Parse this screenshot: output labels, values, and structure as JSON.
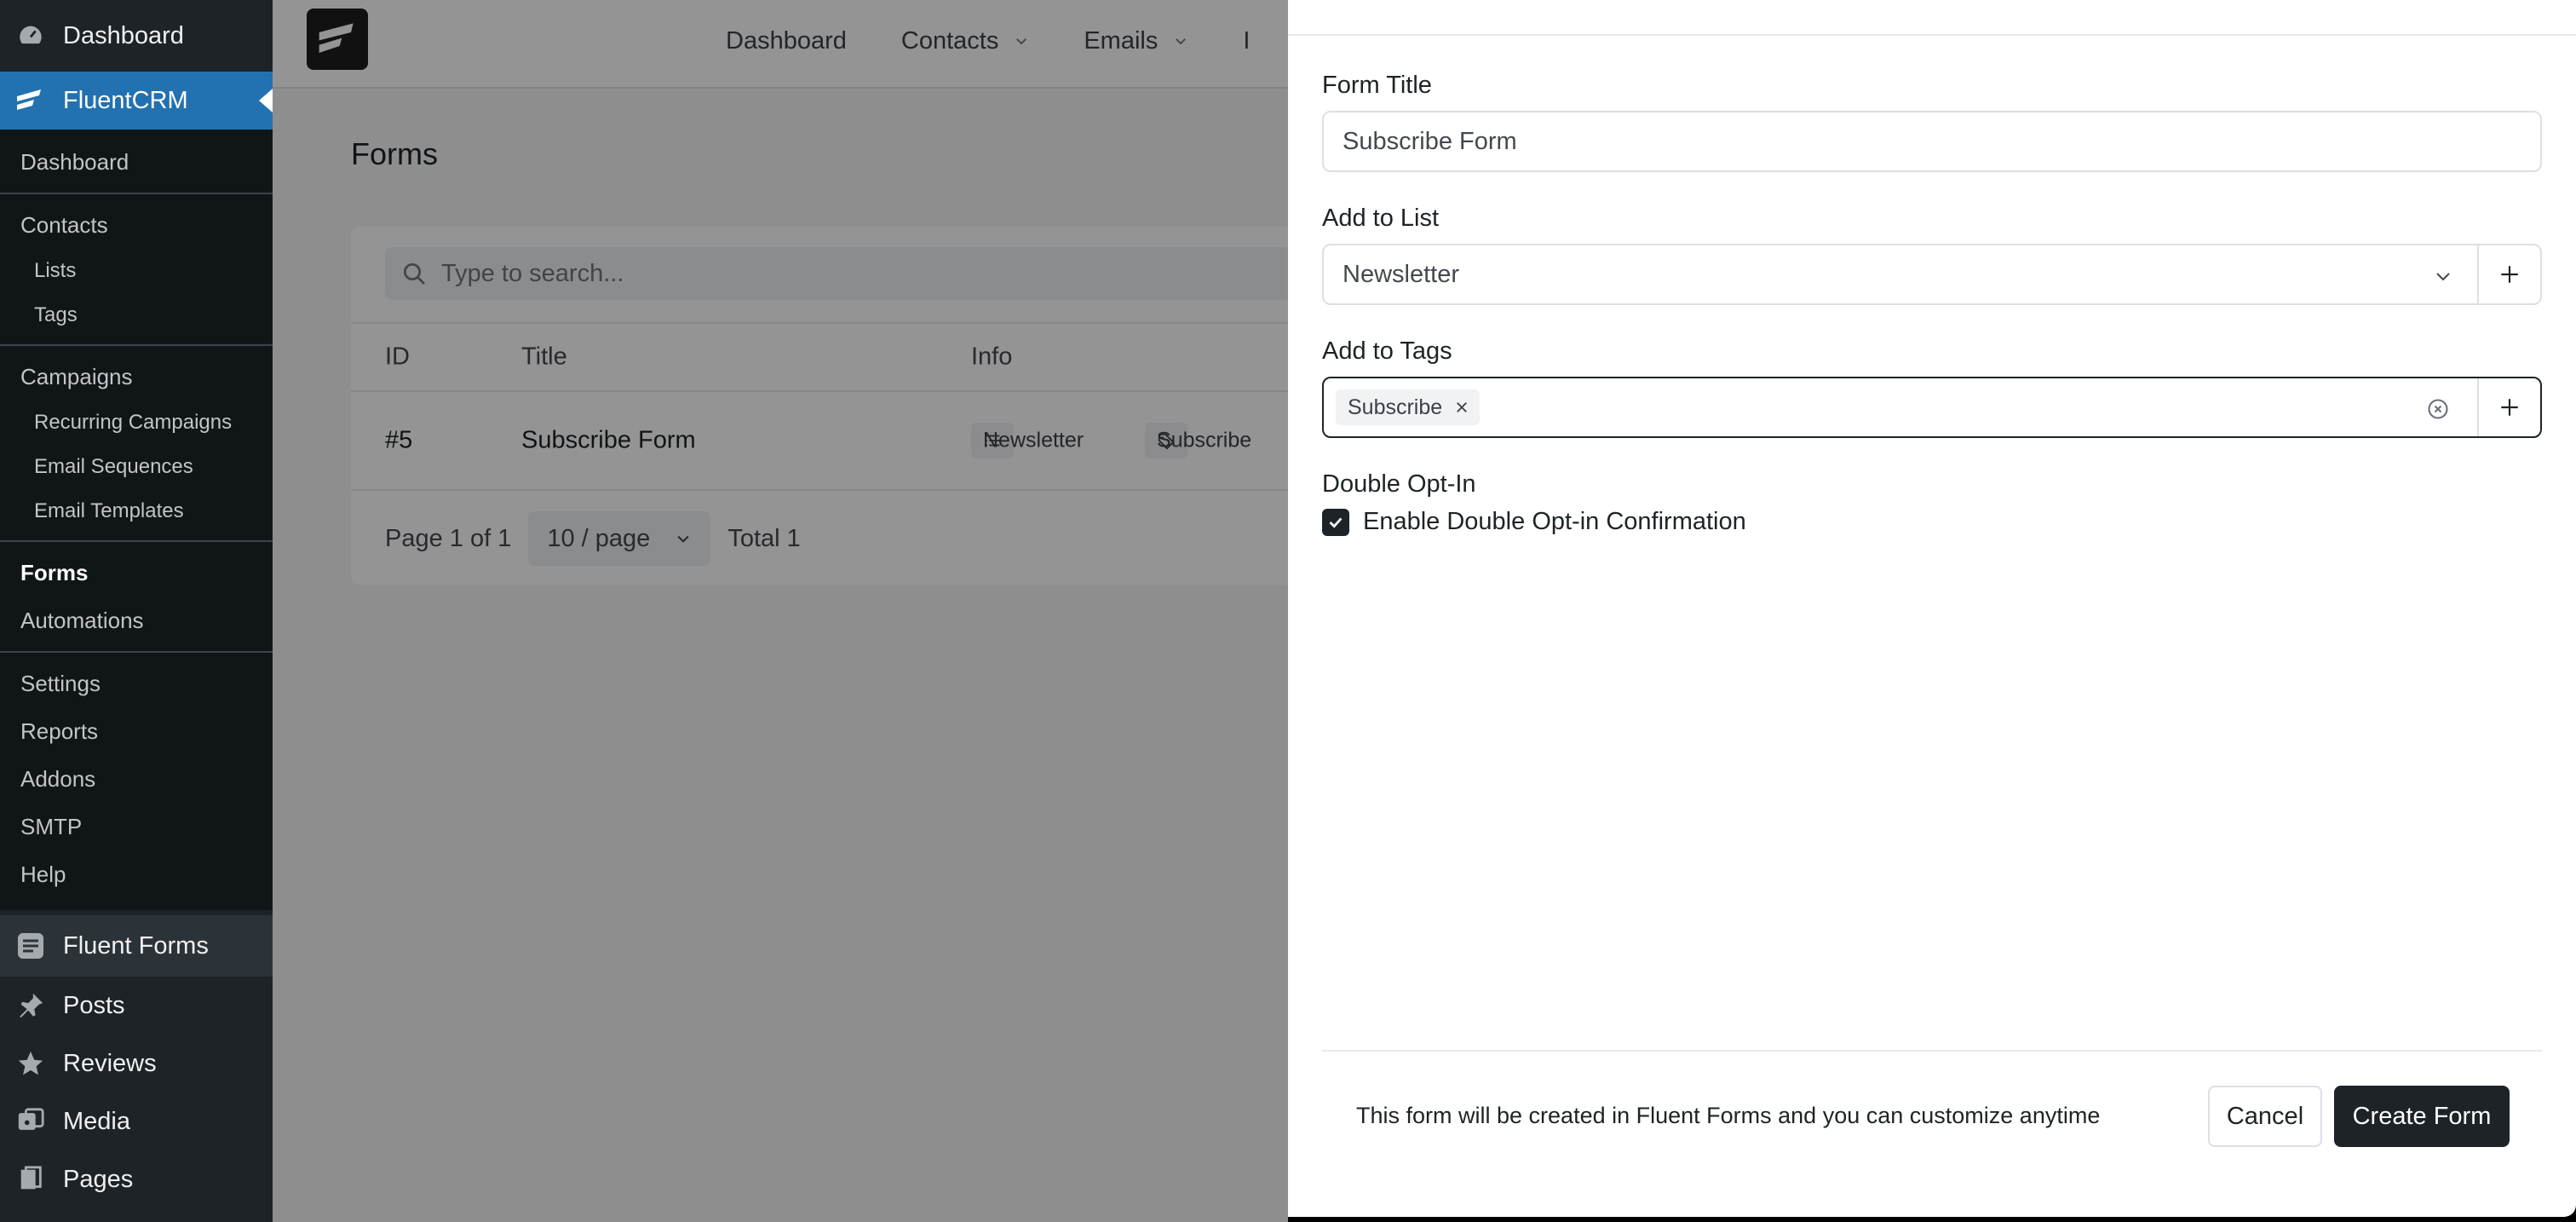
{
  "wp_sidebar": {
    "dashboard": "Dashboard",
    "fluentcrm": "FluentCRM",
    "submenu": {
      "dashboard": "Dashboard",
      "contacts": "Contacts",
      "lists": "Lists",
      "tags": "Tags",
      "campaigns": "Campaigns",
      "recurring_campaigns": "Recurring Campaigns",
      "email_sequences": "Email Sequences",
      "email_templates": "Email Templates",
      "forms": "Forms",
      "automations": "Automations",
      "settings": "Settings",
      "reports": "Reports",
      "addons": "Addons",
      "smtp": "SMTP",
      "help": "Help"
    },
    "fluent_forms": "Fluent Forms",
    "posts": "Posts",
    "reviews": "Reviews",
    "media": "Media",
    "pages": "Pages"
  },
  "topnav": {
    "dashboard": "Dashboard",
    "contacts": "Contacts",
    "emails": "Emails",
    "partial": "I"
  },
  "forms_page": {
    "title": "Forms",
    "search_placeholder": "Type to search...",
    "columns": {
      "id": "ID",
      "title": "Title",
      "info": "Info"
    },
    "row": {
      "id": "#5",
      "title": "Subscribe Form",
      "list_chip": "Newsletter",
      "tag_chip": "Subscribe"
    },
    "pager": {
      "page_text": "Page 1 of 1",
      "per_page": "10 / page",
      "total": "Total 1"
    }
  },
  "drawer": {
    "form_title_label": "Form Title",
    "form_title_value": "Subscribe Form",
    "add_to_list_label": "Add to List",
    "add_to_list_value": "Newsletter",
    "add_to_tags_label": "Add to Tags",
    "tags": [
      "Subscribe"
    ],
    "double_optin_label": "Double Opt-In",
    "double_optin_checkbox": "Enable Double Opt-in Confirmation",
    "double_optin_checked": true,
    "footer_note": "This form will be created in Fluent Forms and you can customize anytime",
    "cancel_label": "Cancel",
    "create_label": "Create Form"
  }
}
